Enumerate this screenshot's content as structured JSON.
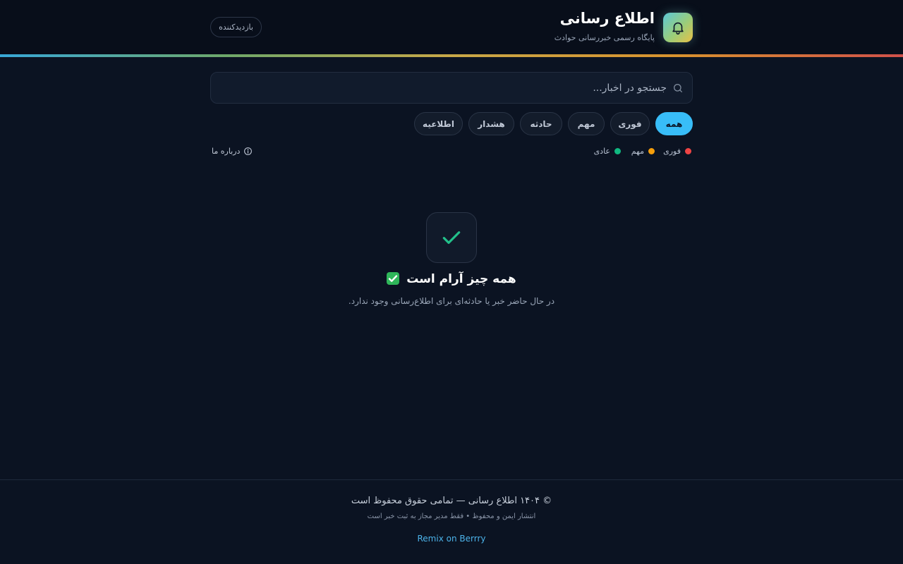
{
  "header": {
    "title": "اطلاع رسانی",
    "subtitle": "پایگاه رسمی خبررسانی حوادث",
    "visitor_label": "بازدیدکننده",
    "icon": "bell-icon"
  },
  "search": {
    "placeholder": "جستجو در اخبار...",
    "value": "",
    "icon": "search-icon"
  },
  "filters": {
    "items": [
      {
        "label": "همه",
        "active": true
      },
      {
        "label": "فوری",
        "active": false
      },
      {
        "label": "مهم",
        "active": false
      },
      {
        "label": "حادثه",
        "active": false
      },
      {
        "label": "هشدار",
        "active": false
      },
      {
        "label": "اطلاعیه",
        "active": false
      }
    ]
  },
  "legend": {
    "items": [
      {
        "label": "فوری",
        "color": "#ef4444"
      },
      {
        "label": "مهم",
        "color": "#f59e0b"
      },
      {
        "label": "عادی",
        "color": "#10b981"
      }
    ],
    "about_label": "درباره ما"
  },
  "empty_state": {
    "title": "همه چیز آرام است",
    "subtitle": "در حال حاضر خبر یا حادثه‌ای برای اطلاع‌رسانی وجود ندارد.",
    "icon": "check-icon"
  },
  "footer": {
    "copyright": "© ۱۴۰۴ اطلاع رسانی — تمامی حقوق محفوظ است",
    "note": "انتشار ایمن و محفوظ • فقط مدیر مجاز به ثبت خبر است",
    "link_label": "Remix on Berrry"
  },
  "colors": {
    "accent": "#38bdf8",
    "background": "#0b1322"
  }
}
